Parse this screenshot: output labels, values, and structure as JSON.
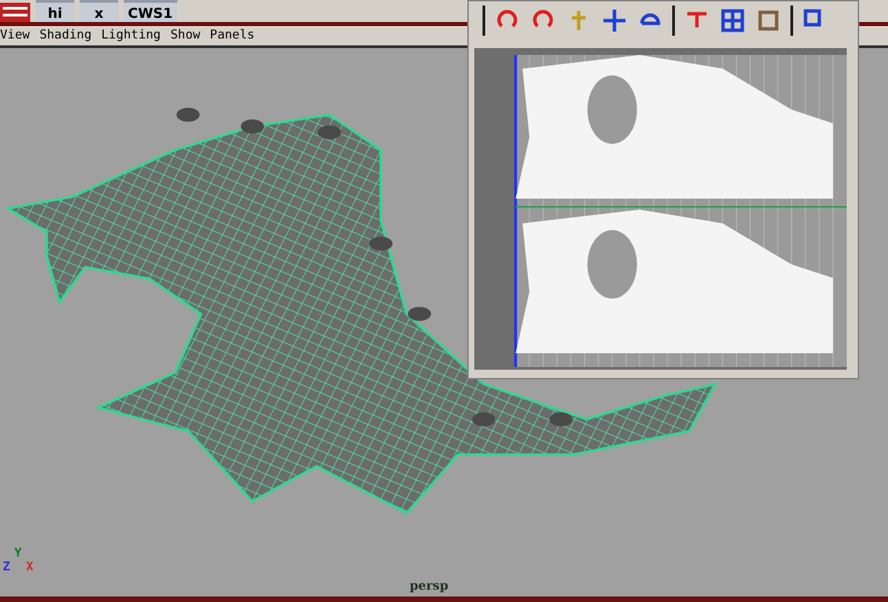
{
  "shelf": {
    "buttons": [
      {
        "label": "hi"
      },
      {
        "label": "x"
      },
      {
        "label": "CWS1"
      }
    ]
  },
  "menu": [
    {
      "label": "View"
    },
    {
      "label": "Shading"
    },
    {
      "label": "Lighting"
    },
    {
      "label": "Show"
    },
    {
      "label": "Panels"
    }
  ],
  "viewport": {
    "camera": "persp",
    "axes": [
      {
        "label": "Y",
        "color": "#107a20"
      },
      {
        "label": "Z",
        "color": "#3030d0"
      },
      {
        "label": "X",
        "color": "#d03030"
      }
    ]
  }
}
